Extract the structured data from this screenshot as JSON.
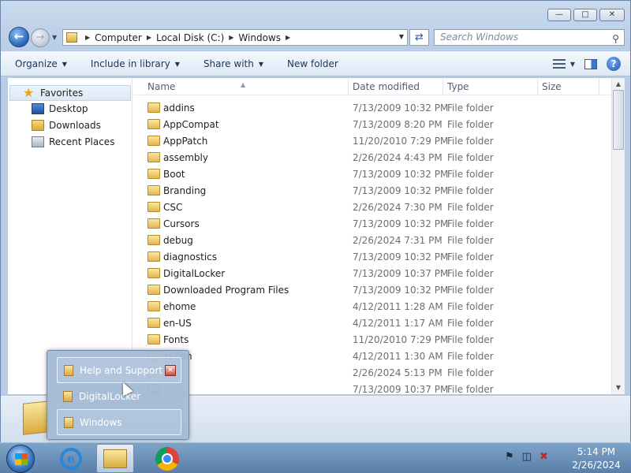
{
  "window": {
    "minimize_icon": "minimize-icon",
    "maximize_icon": "maximize-icon",
    "close_icon": "close-icon"
  },
  "nav": {
    "back_glyph": "←",
    "forward_glyph": "→"
  },
  "address": {
    "crumbs": [
      "Computer",
      "Local Disk (C:)",
      "Windows"
    ]
  },
  "search": {
    "placeholder": "Search Windows"
  },
  "toolbar": {
    "organize": "Organize",
    "include_in_library": "Include in library",
    "share_with": "Share with",
    "new_folder": "New folder"
  },
  "navpane": {
    "favorites": "Favorites",
    "items": [
      "Desktop",
      "Downloads",
      "Recent Places"
    ]
  },
  "columns": {
    "name": "Name",
    "date_modified": "Date modified",
    "type": "Type",
    "size": "Size"
  },
  "files": [
    {
      "name": "addins",
      "date": "7/13/2009 10:32 PM",
      "type": "File folder"
    },
    {
      "name": "AppCompat",
      "date": "7/13/2009 8:20 PM",
      "type": "File folder"
    },
    {
      "name": "AppPatch",
      "date": "11/20/2010 7:29 PM",
      "type": "File folder"
    },
    {
      "name": "assembly",
      "date": "2/26/2024 4:43 PM",
      "type": "File folder"
    },
    {
      "name": "Boot",
      "date": "7/13/2009 10:32 PM",
      "type": "File folder"
    },
    {
      "name": "Branding",
      "date": "7/13/2009 10:32 PM",
      "type": "File folder"
    },
    {
      "name": "CSC",
      "date": "2/26/2024 7:30 PM",
      "type": "File folder"
    },
    {
      "name": "Cursors",
      "date": "7/13/2009 10:32 PM",
      "type": "File folder"
    },
    {
      "name": "debug",
      "date": "2/26/2024 7:31 PM",
      "type": "File folder"
    },
    {
      "name": "diagnostics",
      "date": "7/13/2009 10:32 PM",
      "type": "File folder"
    },
    {
      "name": "DigitalLocker",
      "date": "7/13/2009 10:37 PM",
      "type": "File folder"
    },
    {
      "name": "Downloaded Program Files",
      "date": "7/13/2009 10:32 PM",
      "type": "File folder"
    },
    {
      "name": "ehome",
      "date": "4/12/2011 1:28 AM",
      "type": "File folder"
    },
    {
      "name": "en-US",
      "date": "4/12/2011 1:17 AM",
      "type": "File folder"
    },
    {
      "name": "Fonts",
      "date": "11/20/2010 7:29 PM",
      "type": "File folder"
    },
    {
      "name": "zation",
      "date": "4/12/2011 1:30 AM",
      "type": "File folder"
    },
    {
      "name": "",
      "date": "2/26/2024 5:13 PM",
      "type": "File folder"
    },
    {
      "name": "",
      "date": "7/13/2009 10:37 PM",
      "type": "File folder"
    }
  ],
  "jumplist": {
    "items": [
      "Help and Support",
      "DigitalLocker",
      "Windows"
    ]
  },
  "taskbar": {
    "ie_glyph": "e",
    "time": "5:14 PM",
    "date": "2/26/2024"
  }
}
